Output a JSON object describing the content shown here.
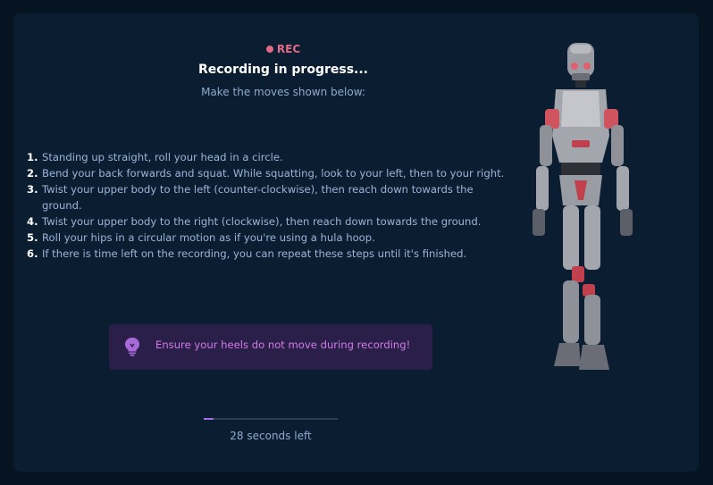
{
  "status": {
    "rec_label": "REC",
    "title": "Recording in progress...",
    "subtitle": "Make the moves shown below:"
  },
  "steps": [
    {
      "number": "1.",
      "text": "Standing up straight, roll your head in a circle."
    },
    {
      "number": "2.",
      "text": "Bend your back forwards and squat. While squatting, look to your left, then to your right."
    },
    {
      "number": "3.",
      "text": "Twist your upper body to the left (counter-clockwise), then reach down towards the ground."
    },
    {
      "number": "4.",
      "text": "Twist your upper body to the right (clockwise), then reach down towards the ground."
    },
    {
      "number": "5.",
      "text": "Roll your hips in a circular motion as if you're using a hula hoop."
    },
    {
      "number": "6.",
      "text": "If there is time left on the recording, you can repeat these steps until it's finished."
    }
  ],
  "tip": {
    "icon": "lightbulb-icon",
    "text": "Ensure your heels do not move during recording!"
  },
  "progress": {
    "fraction": 0.07,
    "time_left": "28 seconds left"
  },
  "colors": {
    "rec": "#e06a87",
    "accent": "#a66fe0",
    "tip_text": "#d27be8"
  }
}
